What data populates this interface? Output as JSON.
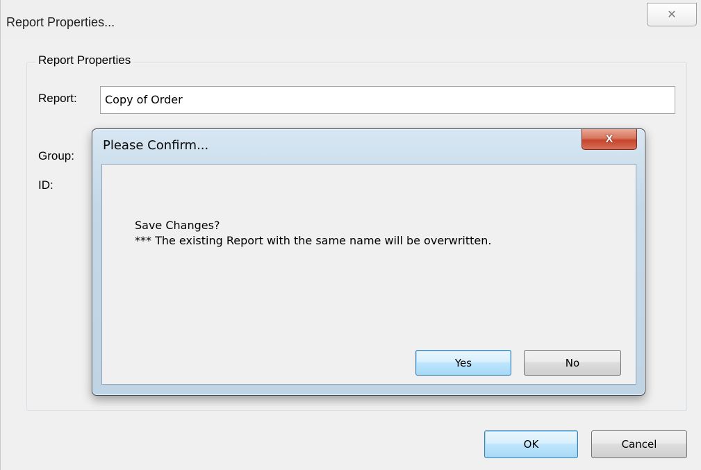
{
  "window": {
    "title": "Report Properties...",
    "close_glyph": "✕"
  },
  "group": {
    "legend": "Report Properties"
  },
  "fields": {
    "report_label": "Report:",
    "report_value": "Copy of Order",
    "group_label": "Group:",
    "id_label": "ID:"
  },
  "footer": {
    "ok_label": "OK",
    "cancel_label": "Cancel"
  },
  "confirm": {
    "title": "Please Confirm...",
    "close_glyph": "X",
    "message_line1": "Save Changes?",
    "message_line2": "*** The existing Report with the same name will be overwritten.",
    "yes_label": "Yes",
    "no_label": "No"
  },
  "colors": {
    "dialog_bg": "#f0f0f0",
    "modal_frame": "#c3d8e8",
    "close_red": "#c8452c",
    "default_button_border": "#3c7fb1"
  }
}
